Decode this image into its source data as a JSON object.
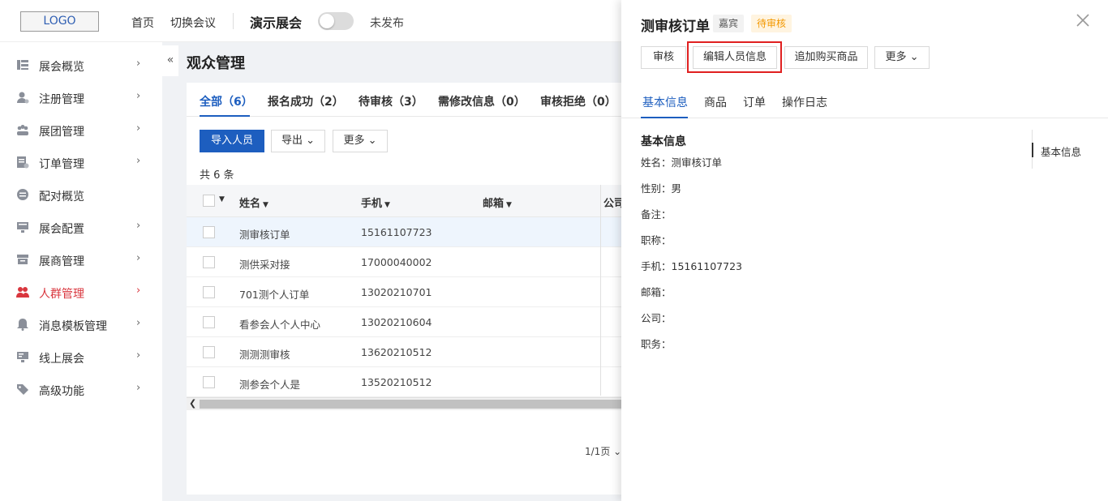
{
  "topbar": {
    "logo": "LOGO",
    "nav": [
      "首页",
      "切换会议"
    ],
    "expo_name": "演示展会",
    "publish_status": "未发布"
  },
  "sidebar": {
    "items": [
      {
        "label": "展会概览",
        "icon": "dashboard-icon",
        "has_children": true,
        "active": false
      },
      {
        "label": "注册管理",
        "icon": "user-register-icon",
        "has_children": true,
        "active": false
      },
      {
        "label": "展团管理",
        "icon": "group-icon",
        "has_children": true,
        "active": false
      },
      {
        "label": "订单管理",
        "icon": "order-icon",
        "has_children": true,
        "active": false
      },
      {
        "label": "配对概览",
        "icon": "match-icon",
        "has_children": false,
        "active": false
      },
      {
        "label": "展会配置",
        "icon": "config-icon",
        "has_children": true,
        "active": false
      },
      {
        "label": "展商管理",
        "icon": "store-icon",
        "has_children": true,
        "active": false
      },
      {
        "label": "人群管理",
        "icon": "people-icon",
        "has_children": true,
        "active": true
      },
      {
        "label": "消息模板管理",
        "icon": "bell-icon",
        "has_children": true,
        "active": false
      },
      {
        "label": "线上展会",
        "icon": "monitor-icon",
        "has_children": true,
        "active": false
      },
      {
        "label": "高级功能",
        "icon": "tag-icon",
        "has_children": true,
        "active": false
      }
    ]
  },
  "main": {
    "collapse_icon": "«",
    "title": "观众管理",
    "tabs": [
      "全部（6）",
      "报名成功（2）",
      "待审核（3）",
      "需修改信息（0）",
      "审核拒绝（0）"
    ],
    "buttons": {
      "import": "导入人员",
      "export": "导出",
      "more": "更多"
    },
    "total": "共 6 条",
    "columns": [
      "姓名",
      "手机",
      "邮箱",
      "公司"
    ],
    "rows": [
      {
        "name": "测审核订单",
        "phone": "15161107723"
      },
      {
        "name": "测供采对接",
        "phone": "17000040002"
      },
      {
        "name": "701测个人订单",
        "phone": "13020210701"
      },
      {
        "name": "看参会人个人中心",
        "phone": "13020210604"
      },
      {
        "name": "测测测审核",
        "phone": "13620210512"
      },
      {
        "name": "测参会个人是",
        "phone": "13520210512"
      }
    ],
    "pager": "1/1页"
  },
  "drawer": {
    "title": "测审核订单",
    "tag_role": "嘉宾",
    "tag_status": "待审核",
    "buttons": {
      "review": "审核",
      "edit": "编辑人员信息",
      "add_goods": "追加购买商品",
      "more": "更多"
    },
    "tabs": [
      "基本信息",
      "商品",
      "订单",
      "操作日志"
    ],
    "section_title": "基本信息",
    "fields": [
      "姓名：测审核订单",
      "性别：男",
      "备注：",
      "职称：",
      "手机：15161107723",
      "邮箱：",
      "公司：",
      "职务："
    ],
    "anchor": "基本信息"
  },
  "colors": {
    "primary": "#1d5ebf",
    "active_nav": "#d9363e",
    "pending": "#f39800",
    "highlight": "#e02020"
  }
}
